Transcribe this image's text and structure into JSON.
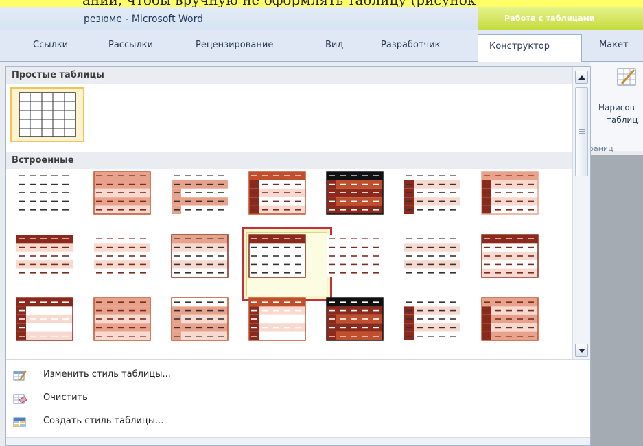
{
  "window": {
    "top_text": "ании, чтобы вручную не  оформлять таблицу (рисунок",
    "title": "резюме - Microsoft Word",
    "context_group": "Работа с таблицами"
  },
  "tabs": [
    {
      "label": "Ссылки"
    },
    {
      "label": "Рассылки"
    },
    {
      "label": "Рецензирование"
    },
    {
      "label": "Вид"
    },
    {
      "label": "Разработчик"
    },
    {
      "label": "Конструктор"
    },
    {
      "label": "Макет"
    }
  ],
  "ribbon": {
    "draw_label_1": "Нарисов",
    "draw_label_2": "таблиц",
    "group_label": "раниц"
  },
  "gallery": {
    "section_plain": "Простые таблицы",
    "section_builtin": "Встроенные"
  },
  "menu": [
    {
      "label": "Изменить стиль таблицы...",
      "icon": "modify-style-icon"
    },
    {
      "label": "Очистить",
      "icon": "clear-icon"
    },
    {
      "label": "Создать стиль таблицы...",
      "icon": "new-style-icon"
    }
  ],
  "colors": {
    "accent_dark": "#8b2a1c",
    "accent_mid": "#c0502d",
    "accent_light": "#e8a28c",
    "context_tab": "#c5da3c",
    "highlight_border": "#c4303a"
  }
}
